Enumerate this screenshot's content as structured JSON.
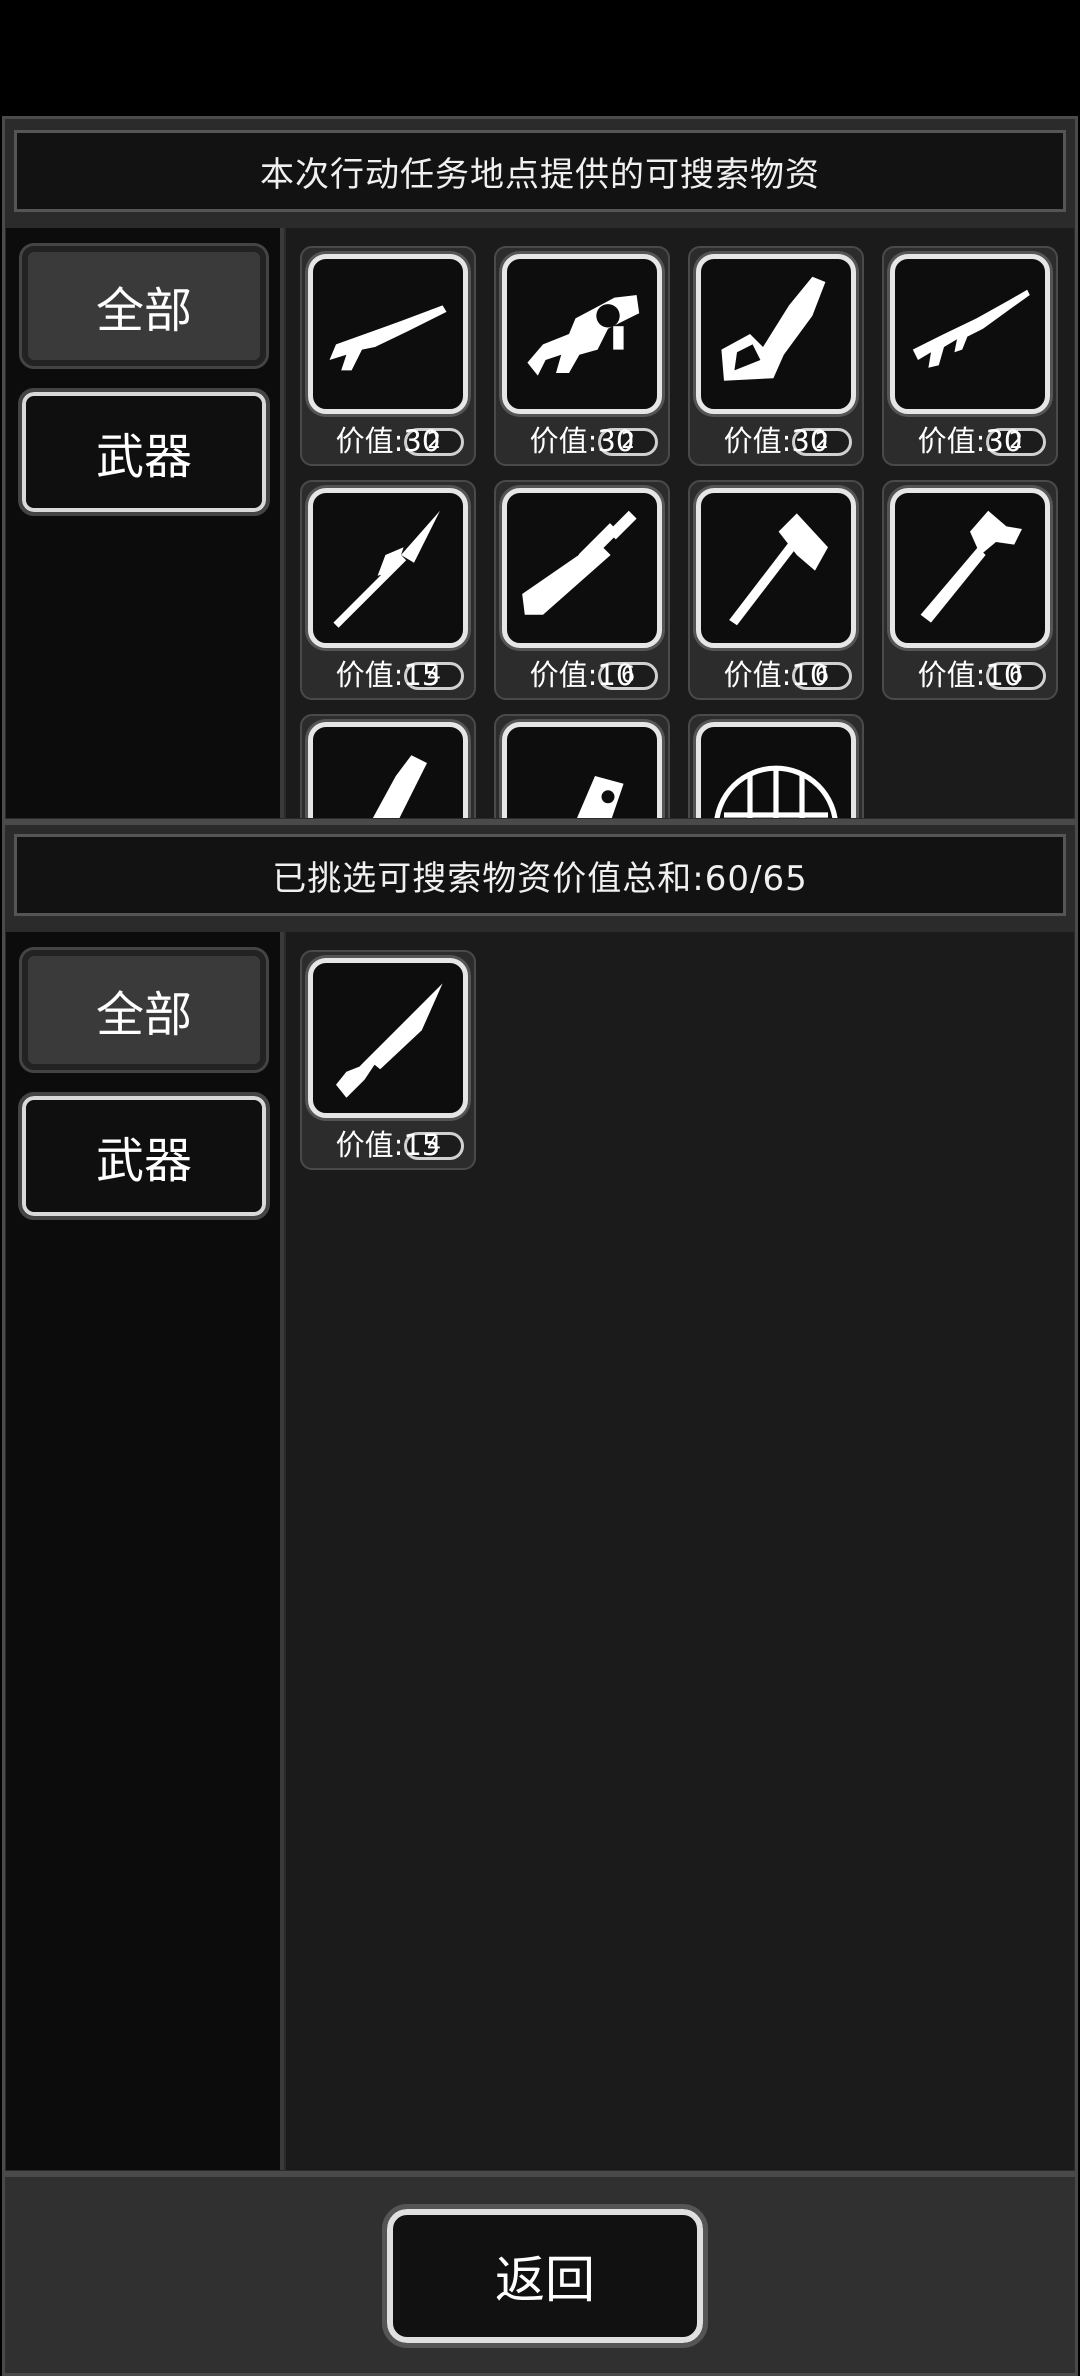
{
  "top_panel": {
    "title": "本次行动任务地点提供的可搜索物资",
    "tabs": [
      {
        "label": "全部"
      },
      {
        "label": "武器"
      }
    ],
    "items": [
      {
        "icon": "shotgun-icon",
        "count": "2",
        "value": "价值:30"
      },
      {
        "icon": "grenade-launcher-icon",
        "count": "2",
        "value": "价值:30"
      },
      {
        "icon": "chainsaw-icon",
        "count": "2",
        "value": "价值:30"
      },
      {
        "icon": "assault-rifle-icon",
        "count": "2",
        "value": "价值:30"
      },
      {
        "icon": "spear-icon",
        "count": "4",
        "value": "价值:15"
      },
      {
        "icon": "sword-icon",
        "count": "6",
        "value": "价值:10"
      },
      {
        "icon": "axe-icon",
        "count": "6",
        "value": "价值:10"
      },
      {
        "icon": "hammer-icon",
        "count": "6",
        "value": "价值:10"
      },
      {
        "icon": "chainsaw-blade-icon",
        "count": "",
        "value": ""
      },
      {
        "icon": "launcher-tube-icon",
        "count": "",
        "value": ""
      },
      {
        "icon": "net-icon",
        "count": "",
        "value": ""
      }
    ]
  },
  "bottom_panel": {
    "title": "已挑选可搜索物资价值总和:60/65",
    "tabs": [
      {
        "label": "全部"
      },
      {
        "label": "武器"
      }
    ],
    "items": [
      {
        "icon": "knife-icon",
        "count": "4",
        "value": "价值:15"
      }
    ]
  },
  "footer": {
    "return_label": "返回"
  },
  "colors": {
    "background": "#000000",
    "panel": "#2b2b2b",
    "grid": "#1b1b1b",
    "sidebar": "#0c0c0c"
  }
}
